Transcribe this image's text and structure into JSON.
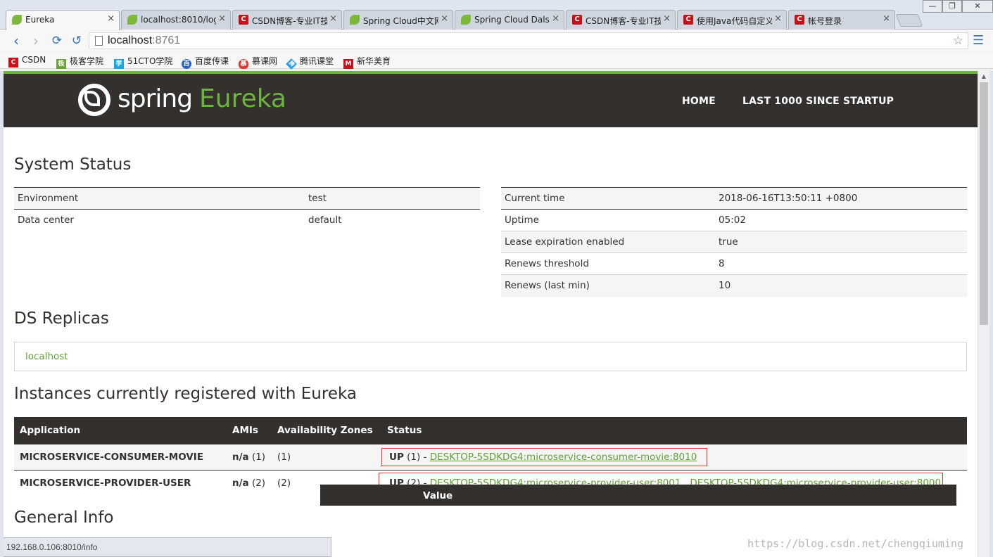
{
  "browser": {
    "tabs": [
      {
        "title": "Eureka",
        "icon": "spring-leaf-icon",
        "active": true
      },
      {
        "title": "localhost:8010/log",
        "icon": "spring-leaf-icon"
      },
      {
        "title": "CSDN博客-专业IT技",
        "icon": "csdn-icon"
      },
      {
        "title": "Spring Cloud中文网",
        "icon": "spring-leaf-icon"
      },
      {
        "title": "Spring Cloud Dals",
        "icon": "spring-leaf-icon"
      },
      {
        "title": "CSDN博客-专业IT技",
        "icon": "csdn-icon"
      },
      {
        "title": "使用Java代码自定义",
        "icon": "csdn-icon"
      },
      {
        "title": "帐号登录",
        "icon": "csdn-icon"
      }
    ],
    "close_glyph": "×",
    "window_controls": {
      "minimize": "—",
      "maximize": "❐",
      "close": "✕"
    },
    "url_host": "localhost",
    "url_port": ":8761",
    "bookmarks": [
      {
        "label": "CSDN",
        "color": "#c8111a",
        "glyph": "C"
      },
      {
        "label": "极客学院",
        "color": "#6aa53c",
        "glyph": "极"
      },
      {
        "label": "51CTO学院",
        "color": "#1aa5e0",
        "glyph": "学"
      },
      {
        "label": "百度传课",
        "color": "#2e62c8",
        "glyph": "百"
      },
      {
        "label": "慕课网",
        "color": "#e2352c",
        "glyph": "慕"
      },
      {
        "label": "腾讯课堂",
        "color": "#2aa0e6",
        "glyph": "腾"
      },
      {
        "label": "新华美育",
        "color": "#c8111a",
        "glyph": "M"
      }
    ],
    "status_url": "192.168.0.106:8010/info"
  },
  "header": {
    "logo_spring": "spring",
    "logo_eureka": "Eureka",
    "nav": [
      "HOME",
      "LAST 1000 SINCE STARTUP"
    ]
  },
  "system_status": {
    "title": "System Status",
    "left": [
      {
        "key": "Environment",
        "value": "test"
      },
      {
        "key": "Data center",
        "value": "default"
      }
    ],
    "right": [
      {
        "key": "Current time",
        "value": "2018-06-16T13:50:11 +0800"
      },
      {
        "key": "Uptime",
        "value": "05:02"
      },
      {
        "key": "Lease expiration enabled",
        "value": "true"
      },
      {
        "key": "Renews threshold",
        "value": "8"
      },
      {
        "key": "Renews (last min)",
        "value": "10"
      }
    ]
  },
  "ds_replicas": {
    "title": "DS Replicas",
    "items": [
      "localhost"
    ]
  },
  "instances": {
    "title": "Instances currently registered with Eureka",
    "columns": [
      "Application",
      "AMIs",
      "Availability Zones",
      "Status"
    ],
    "rows": [
      {
        "application": "MICROSERVICE-CONSUMER-MOVIE",
        "amis_label": "n/a",
        "amis_count": "(1)",
        "zones": "(1)",
        "status": "UP",
        "status_count": "(1) -",
        "links": [
          "DESKTOP-5SDKDG4:microservice-consumer-movie:8010"
        ]
      },
      {
        "application": "MICROSERVICE-PROVIDER-USER",
        "amis_label": "n/a",
        "amis_count": "(2)",
        "zones": "(2)",
        "status": "UP",
        "status_count": "(2) -",
        "links": [
          "DESKTOP-5SDKDG4:microservice-provider-user:8001",
          "DESKTOP-5SDKDG4:microservice-provider-user:8000"
        ],
        "link_separator": ","
      }
    ]
  },
  "general_info": {
    "title": "General Info",
    "value_header": "Value"
  },
  "watermark": "https://blog.csdn.net/chengqiuming",
  "colors": {
    "spring_green": "#6db33f",
    "navbar_dark": "#34302d",
    "highlight_red": "#e03030"
  }
}
